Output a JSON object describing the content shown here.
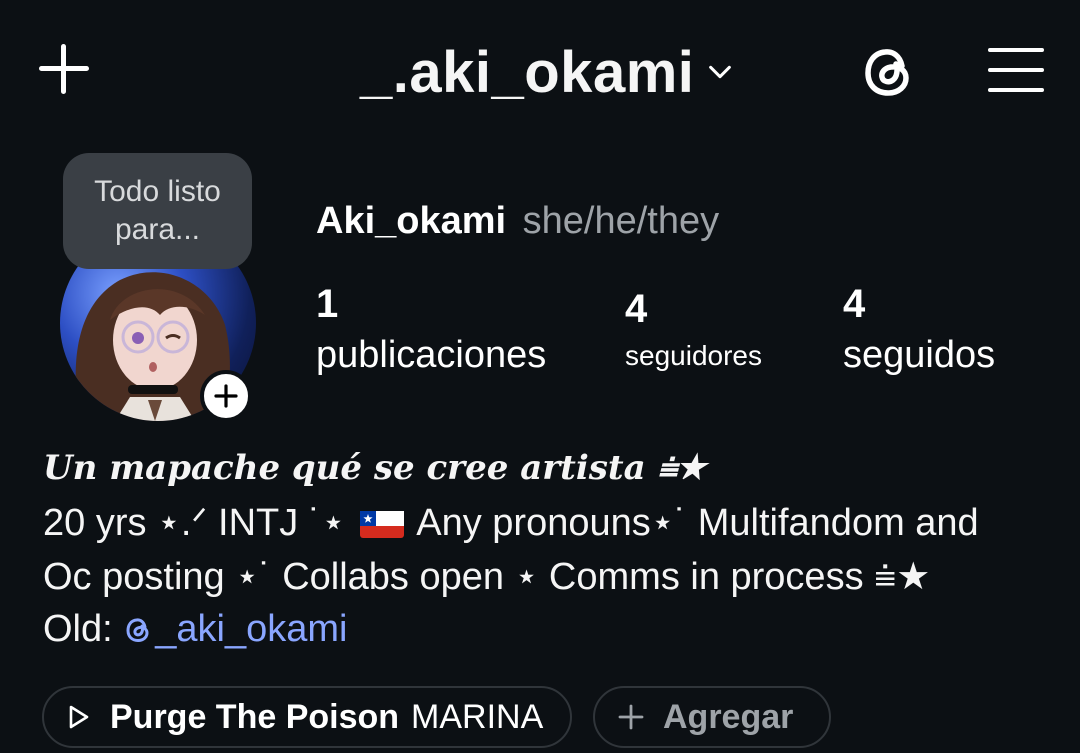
{
  "header": {
    "username": "_.aki_okami",
    "icons": [
      "plus-icon",
      "chevron-down-icon",
      "threads-icon",
      "hamburger-menu-icon"
    ]
  },
  "tooltip": {
    "line1": "Todo listo",
    "line2": "para..."
  },
  "profile": {
    "name": "Aki_okami",
    "pronouns": "she/he/they"
  },
  "stats": [
    {
      "value": "1",
      "label": "publicaciones"
    },
    {
      "value": "4",
      "label": "seguidores"
    },
    {
      "value": "4",
      "label": "seguidos"
    }
  ],
  "bio": {
    "title": "Un mapache qué se cree artista ⩧★",
    "line1_a": "20 yrs ⋆.ᐟ INTJ ˙⋆ ",
    "line1_b": " Any pronouns⋆˙ Multifandom and",
    "line2": "Oc posting ⋆˙ Collabs open ⋆ Comms in process ⩧★",
    "line3_prefix": "Old: ",
    "line3_link": "_aki_okami"
  },
  "chips": {
    "song": "Purge The Poison",
    "artist": "MARINA",
    "add_label": "Agregar"
  },
  "colors": {
    "background": "#0c1014",
    "link": "#8aa6ff",
    "muted": "#9ea3a8",
    "tooltip_bg": "#3a3f45"
  }
}
